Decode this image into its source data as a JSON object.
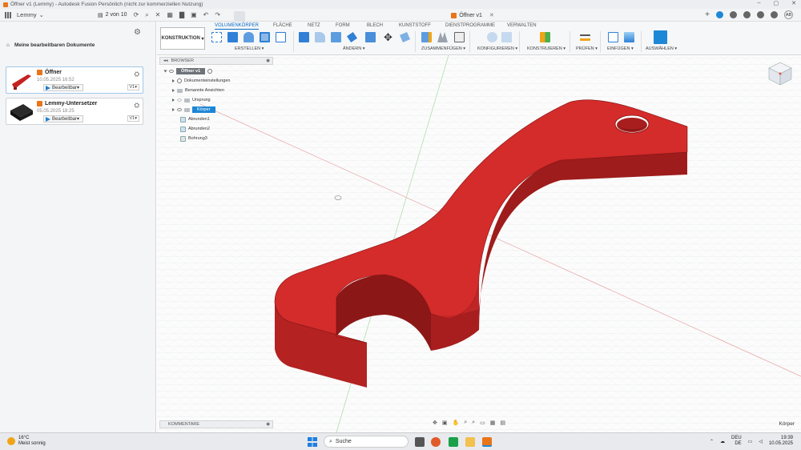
{
  "window": {
    "title": "Öffner v1 (Lemmy) - Autodesk Fusion Persönlich (nicht zur kommerziellen Nutzung)"
  },
  "appbar": {
    "project": "Lemmy",
    "count": "2 von 10"
  },
  "doc_tab": {
    "title": "Öffner v1"
  },
  "user": {
    "initials": "AB"
  },
  "leftpanel": {
    "heading": "Meine bearbeitbaren Dokumente",
    "docs": [
      {
        "name": "Öffner",
        "date": "10.05.2025 16:52",
        "status": "Bearbeitbar",
        "version": "V1"
      },
      {
        "name": "Lemmy-Untersetzer",
        "date": "05.05.2025 18:25",
        "status": "Bearbeitbar",
        "version": "V1"
      }
    ]
  },
  "ribbon": {
    "workspace": "KONSTRUKTION",
    "tabs": [
      "VOLUMENKÖRPER",
      "FLÄCHE",
      "NETZ",
      "FORM",
      "BLECH",
      "KUNSTSTOFF",
      "DIENSTPROGRAMME",
      "VERWALTEN"
    ],
    "groups": [
      "ERSTELLEN",
      "ÄNDERN",
      "ZUSAMMENFÜGEN",
      "KONFIGURIEREN",
      "KONSTRUIEREN",
      "PRÜFEN",
      "EINFÜGEN",
      "AUSWÄHLEN"
    ]
  },
  "browser": {
    "label": "BROWSER",
    "root": "Öffner v1",
    "items": [
      "Dokumenteinstellungen",
      "Benannte Ansichten",
      "Ursprung",
      "Körper",
      "Abrunden1",
      "Abrunden2",
      "Bohrung3"
    ]
  },
  "comments": {
    "label": "KOMMENTARE"
  },
  "status": {
    "selection": "Körper"
  },
  "taskbar": {
    "temp": "16°C",
    "weather": "Meist sonnig",
    "search": "Suche",
    "lang": "DEU",
    "region": "DE",
    "time": "19:39",
    "date": "10.05.2025"
  },
  "colors": {
    "accent": "#1c86d6",
    "model": "#d42b2b",
    "model_side": "#a81e1e"
  }
}
